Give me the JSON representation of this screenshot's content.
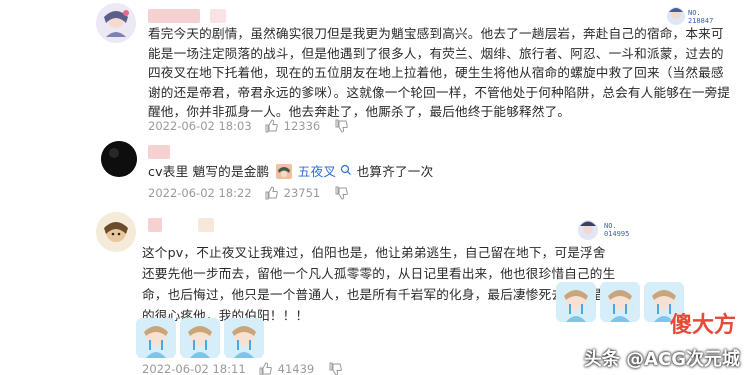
{
  "comments": [
    {
      "username_blurred": true,
      "badge": "NO.\n218847",
      "text": "看完今天的剧情，虽然确实很刀但是我更为魈宝感到高兴。他去了一趟层岩，奔赴自己的宿命，本来可能是一场注定陨落的战斗，但是他遇到了很多人，有荧兰、烟绯、旅行者、阿忍、一斗和派蒙，过去的四夜叉在地下托着他，现在的五位朋友在地上拉着他，硬生生将他从宿命的螺旋中救了回来（当然最感谢的还是帝君，帝君永远的爹咪）。这就像一个轮回一样，不管他处于何种陷阱，总会有人能够在一旁提醒他，你并非孤身一人。他去奔赴了，他厮杀了，最后他终于能够释然了。",
      "date": "2022-06-02 18:03",
      "likes": "12336",
      "like_icon": "thumb-up-icon",
      "dislike_icon": "thumb-down-icon"
    },
    {
      "username_blurred": true,
      "text_prefix": "cv表里 魈写的是金鹏",
      "mention": "五夜叉",
      "text_suffix": "也算齐了一次",
      "date": "2022-06-02 18:22",
      "likes": "23751"
    },
    {
      "username_blurred": true,
      "badge": "NO.\n014995",
      "text": "这个pv，不止夜叉让我难过，伯阳也是，他让弟弟逃生，自己留在地下，可是浮舍还要先他一步而去，留他一个凡人孤零零的，从日记里看出来，他也很珍惜自己的生命，也后悔过，他只是一个普通人，也是所有千岩军的化身，最后凄惨死去。我是真的很心疼他，我的伯阳！！！",
      "date": "2022-06-02 18:11",
      "likes": "41439"
    }
  ],
  "watermark": {
    "logo_text": "傻大方",
    "source": "头条 @ACG次元城"
  },
  "colors": {
    "mention": "#2a6fd6",
    "meta": "#9a9a9a"
  }
}
